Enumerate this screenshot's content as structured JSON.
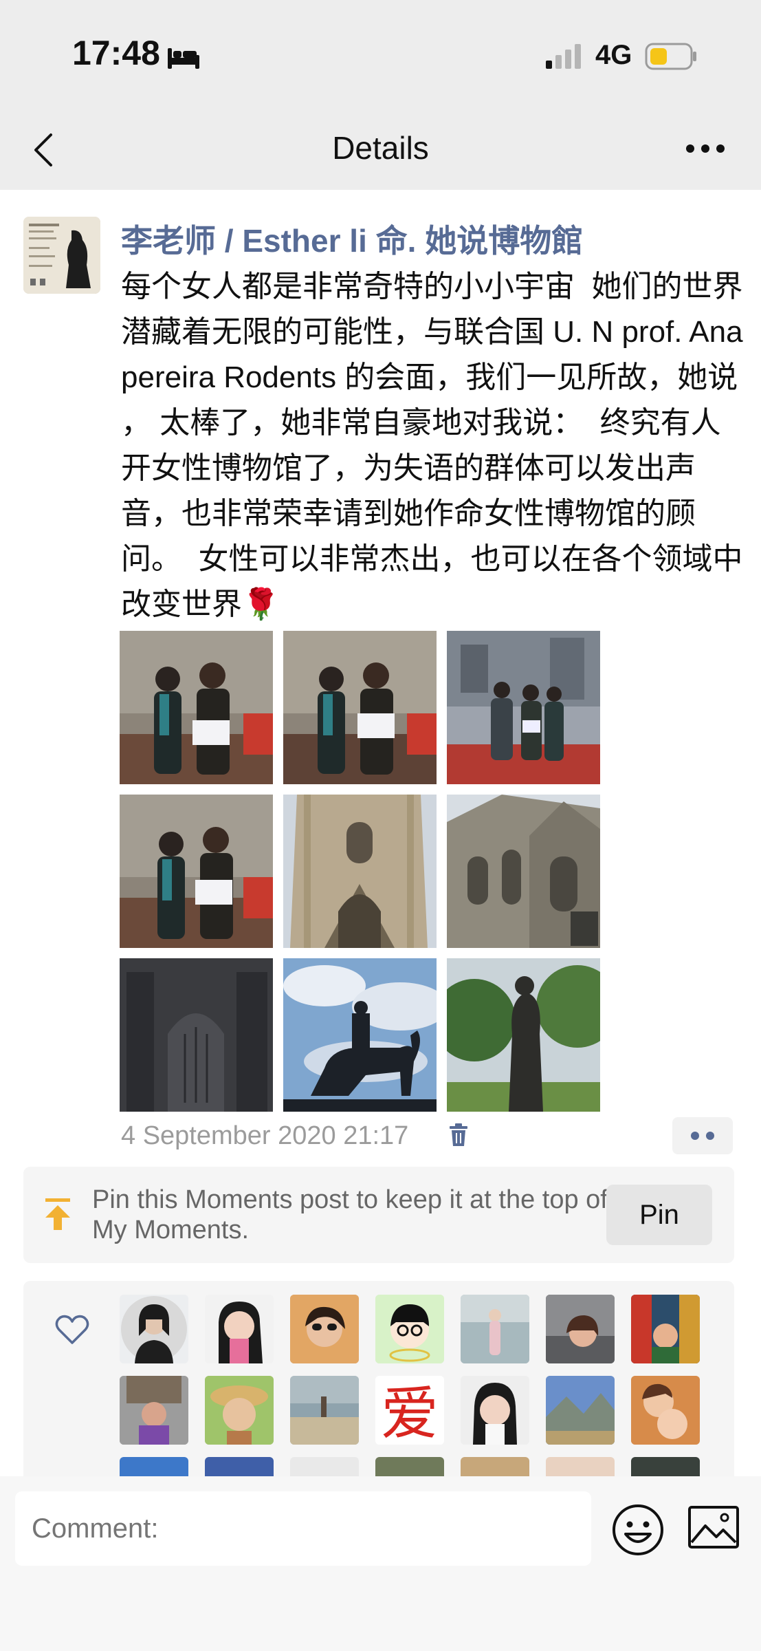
{
  "status_bar": {
    "time": "17:48",
    "network": "4G",
    "icons": [
      "bed-icon",
      "signal-icon",
      "battery-icon"
    ]
  },
  "nav": {
    "title": "Details",
    "icons": [
      "chevron-left-icon",
      "more-icon"
    ]
  },
  "post": {
    "author": "李老师 / Esther li 命. 她说博物館",
    "text": "每个女人都是非常奇特的小小宇宙  她们的世界潜藏着无限的可能性，与联合国 U. N prof. Ana pereira Rodents 的会面，我们一见所故，她说 ， 太棒了，她非常自豪地对我说：  终究有人开女性博物馆了，为失语的群体可以发出声音，也非常荣幸请到她作命女性博物馆的顾问。  女性可以非常杰出，也可以在各个领域中改变世界",
    "emoji": "🌹",
    "photos": [
      "photo-women-certificate-1",
      "photo-women-certificate-2",
      "photo-group-mural",
      "photo-women-certificate-3",
      "photo-church-facade",
      "photo-church-side",
      "photo-church-dark",
      "photo-equestrian-statue",
      "photo-statue-trees"
    ],
    "time": "4 September 2020 21:17",
    "accent_color": "#576b95"
  },
  "pin": {
    "text": "Pin this Moments post to keep it at the top of My Moments.",
    "button_label": "Pin",
    "icon_color": "#f2b133"
  },
  "likes": {
    "icon": "heart-icon",
    "avatar_count_visible": 21
  },
  "comment": {
    "placeholder": "Comment:",
    "icons": [
      "emoji-icon",
      "image-icon"
    ]
  }
}
